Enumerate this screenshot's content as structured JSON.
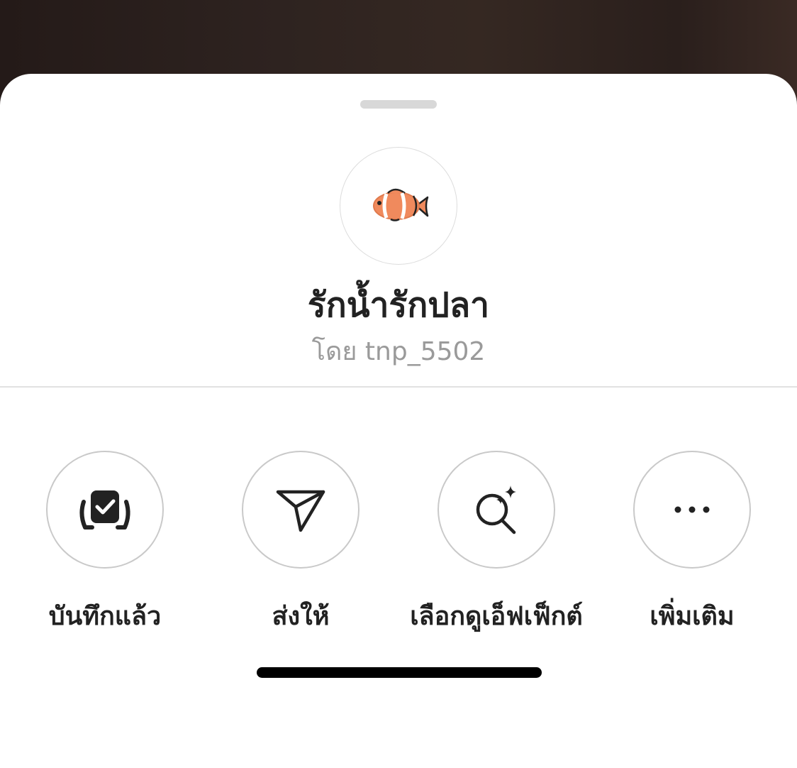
{
  "effect": {
    "name": "รักน้ำรักปลา",
    "creator": "โดย tnp_5502",
    "thumbnail_icon": "clownfish-icon"
  },
  "actions": [
    {
      "label": "บันทึกแล้ว",
      "icon": "saved-check-icon"
    },
    {
      "label": "ส่งให้",
      "icon": "send-icon"
    },
    {
      "label": "เลือกดูเอ็ฟเฟ็กต์",
      "icon": "browse-effects-icon"
    },
    {
      "label": "เพิ่มเติม",
      "icon": "more-icon"
    }
  ],
  "colors": {
    "sheet_background": "#ffffff",
    "text_primary": "#222222",
    "text_secondary": "#9a9a9a",
    "fish_orange": "#f08a5d"
  }
}
